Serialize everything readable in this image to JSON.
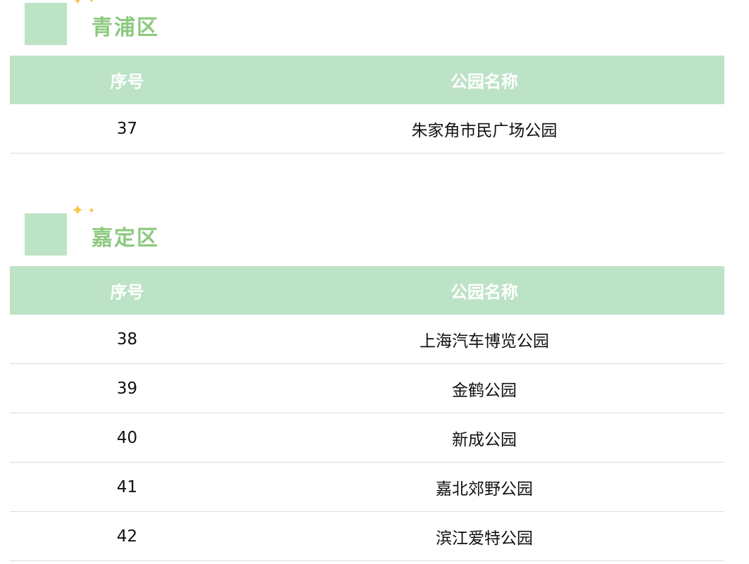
{
  "sections": [
    {
      "district": "青浦区",
      "headers": [
        "序号",
        "公园名称"
      ],
      "rows": [
        {
          "no": "37",
          "name": "朱家角市民广场公园"
        }
      ]
    },
    {
      "district": "嘉定区",
      "headers": [
        "序号",
        "公园名称"
      ],
      "rows": [
        {
          "no": "38",
          "name": "上海汽车博览公园"
        },
        {
          "no": "39",
          "name": "金鹤公园"
        },
        {
          "no": "40",
          "name": "新成公园"
        },
        {
          "no": "41",
          "name": "嘉北郊野公园"
        },
        {
          "no": "42",
          "name": "滨江爱特公园"
        }
      ]
    }
  ],
  "colors": {
    "header_bg": "#bde3c7",
    "title_green": "#8cc97f",
    "sparkle": "#f5c84c"
  },
  "icons": {
    "sparkle": "sparkle-icon"
  }
}
